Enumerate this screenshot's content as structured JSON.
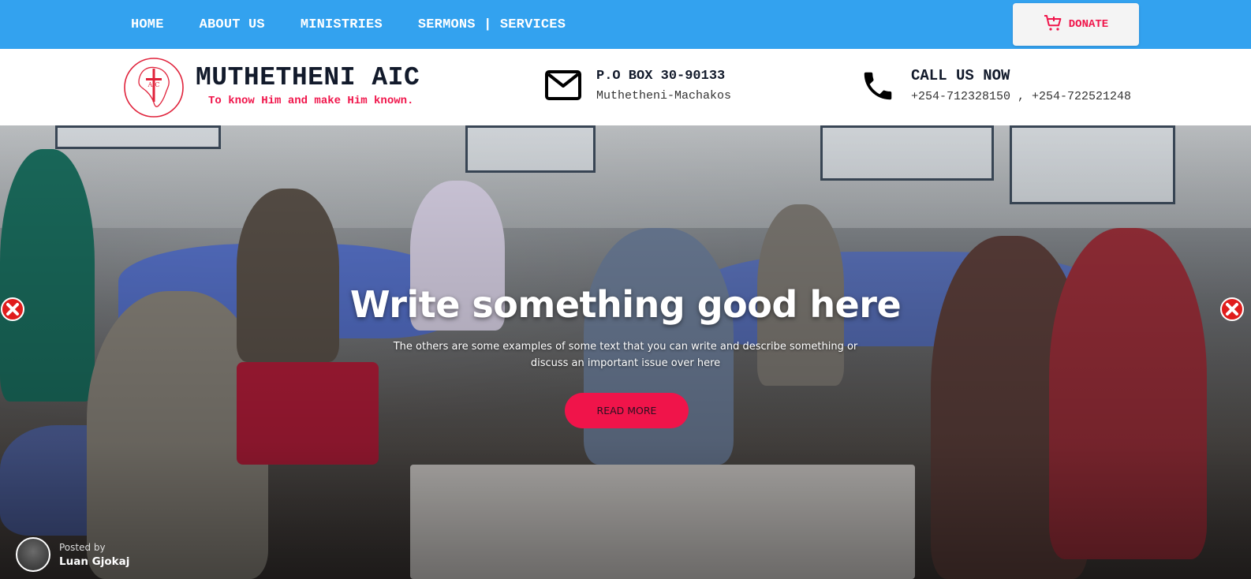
{
  "nav": {
    "items": [
      {
        "label": "HOME"
      },
      {
        "label": "ABOUT US"
      },
      {
        "label": "MINISTRIES"
      },
      {
        "label": "SERMONS | SERVICES"
      }
    ],
    "donate_label": "DONATE",
    "donate_icon": "cart-icon"
  },
  "header": {
    "site_title": "MUTHETHENI AIC",
    "tagline": "To know Him and make Him known.",
    "logo_text": "AIC",
    "address": {
      "icon": "mail-icon",
      "title": "P.O BOX 30-90133",
      "subtitle": "Muthetheni-Machakos"
    },
    "call": {
      "icon": "phone-icon",
      "title": "CALL US NOW",
      "subtitle": "+254-712328150 , +254-722521248"
    }
  },
  "hero": {
    "title": "Write something good here",
    "description": "The others are some examples of some text that you can write and describe something or discuss an important issue over here",
    "button_label": "READ MORE",
    "posted_by_label": "Posted by",
    "author_name": "Luan Gjokaj"
  },
  "colors": {
    "nav_bg": "#33a2ef",
    "accent": "#f0144a",
    "title_dark": "#121a2b"
  }
}
